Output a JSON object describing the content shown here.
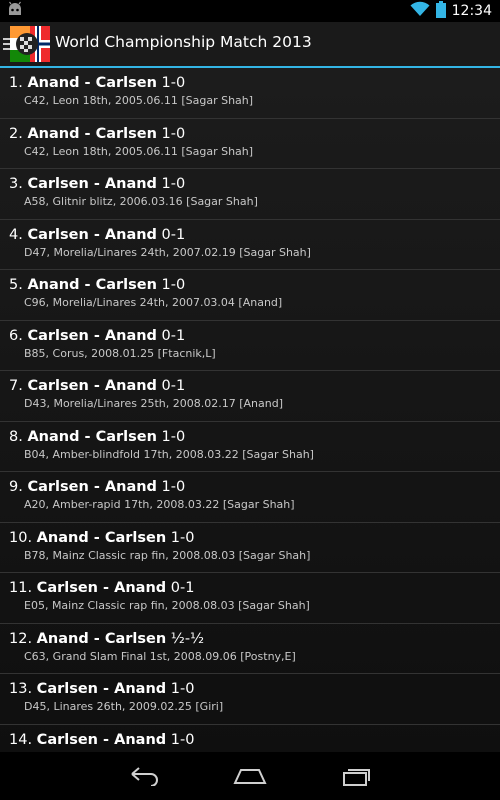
{
  "status_bar": {
    "time": "12:34",
    "icons": [
      "android-notification-icon",
      "wifi-icon",
      "battery-icon"
    ]
  },
  "action_bar": {
    "title": "World Championship Match 2013",
    "app_icon": "chess-flags-app-icon",
    "accent_color": "#33b5e5"
  },
  "games": [
    {
      "number": "1.",
      "players": "Anand - Carlsen",
      "result": "1-0",
      "details": "C42, Leon 18th, 2005.06.11 [Sagar Shah]"
    },
    {
      "number": "2.",
      "players": "Anand - Carlsen",
      "result": "1-0",
      "details": "C42, Leon 18th, 2005.06.11 [Sagar Shah]"
    },
    {
      "number": "3.",
      "players": "Carlsen - Anand",
      "result": "1-0",
      "details": "A58, Glitnir blitz, 2006.03.16 [Sagar Shah]"
    },
    {
      "number": "4.",
      "players": "Carlsen - Anand",
      "result": "0-1",
      "details": "D47, Morelia/Linares 24th, 2007.02.19 [Sagar Shah]"
    },
    {
      "number": "5.",
      "players": "Anand - Carlsen",
      "result": "1-0",
      "details": "C96, Morelia/Linares 24th, 2007.03.04 [Anand]"
    },
    {
      "number": "6.",
      "players": "Carlsen - Anand",
      "result": "0-1",
      "details": "B85, Corus, 2008.01.25 [Ftacnik,L]"
    },
    {
      "number": "7.",
      "players": "Carlsen - Anand",
      "result": "0-1",
      "details": "D43, Morelia/Linares 25th, 2008.02.17 [Anand]"
    },
    {
      "number": "8.",
      "players": "Anand - Carlsen",
      "result": "1-0",
      "details": "B04, Amber-blindfold 17th, 2008.03.22 [Sagar Shah]"
    },
    {
      "number": "9.",
      "players": "Carlsen - Anand",
      "result": "1-0",
      "details": "A20, Amber-rapid 17th, 2008.03.22 [Sagar Shah]"
    },
    {
      "number": "10.",
      "players": "Anand - Carlsen",
      "result": "1-0",
      "details": "B78, Mainz Classic rap fin, 2008.08.03 [Sagar Shah]"
    },
    {
      "number": "11.",
      "players": "Carlsen - Anand",
      "result": "0-1",
      "details": "E05, Mainz Classic rap fin, 2008.08.03 [Sagar Shah]"
    },
    {
      "number": "12.",
      "players": "Anand - Carlsen",
      "result": "½-½",
      "details": "C63, Grand Slam Final 1st, 2008.09.06 [Postny,E]"
    },
    {
      "number": "13.",
      "players": "Carlsen - Anand",
      "result": "1-0",
      "details": "D45, Linares 26th, 2009.02.25 [Giri]"
    },
    {
      "number": "14.",
      "players": "Carlsen - Anand",
      "result": "1-0",
      "details": ""
    }
  ],
  "nav_bar": {
    "buttons": [
      "back-icon",
      "home-icon",
      "recent-apps-icon"
    ]
  }
}
